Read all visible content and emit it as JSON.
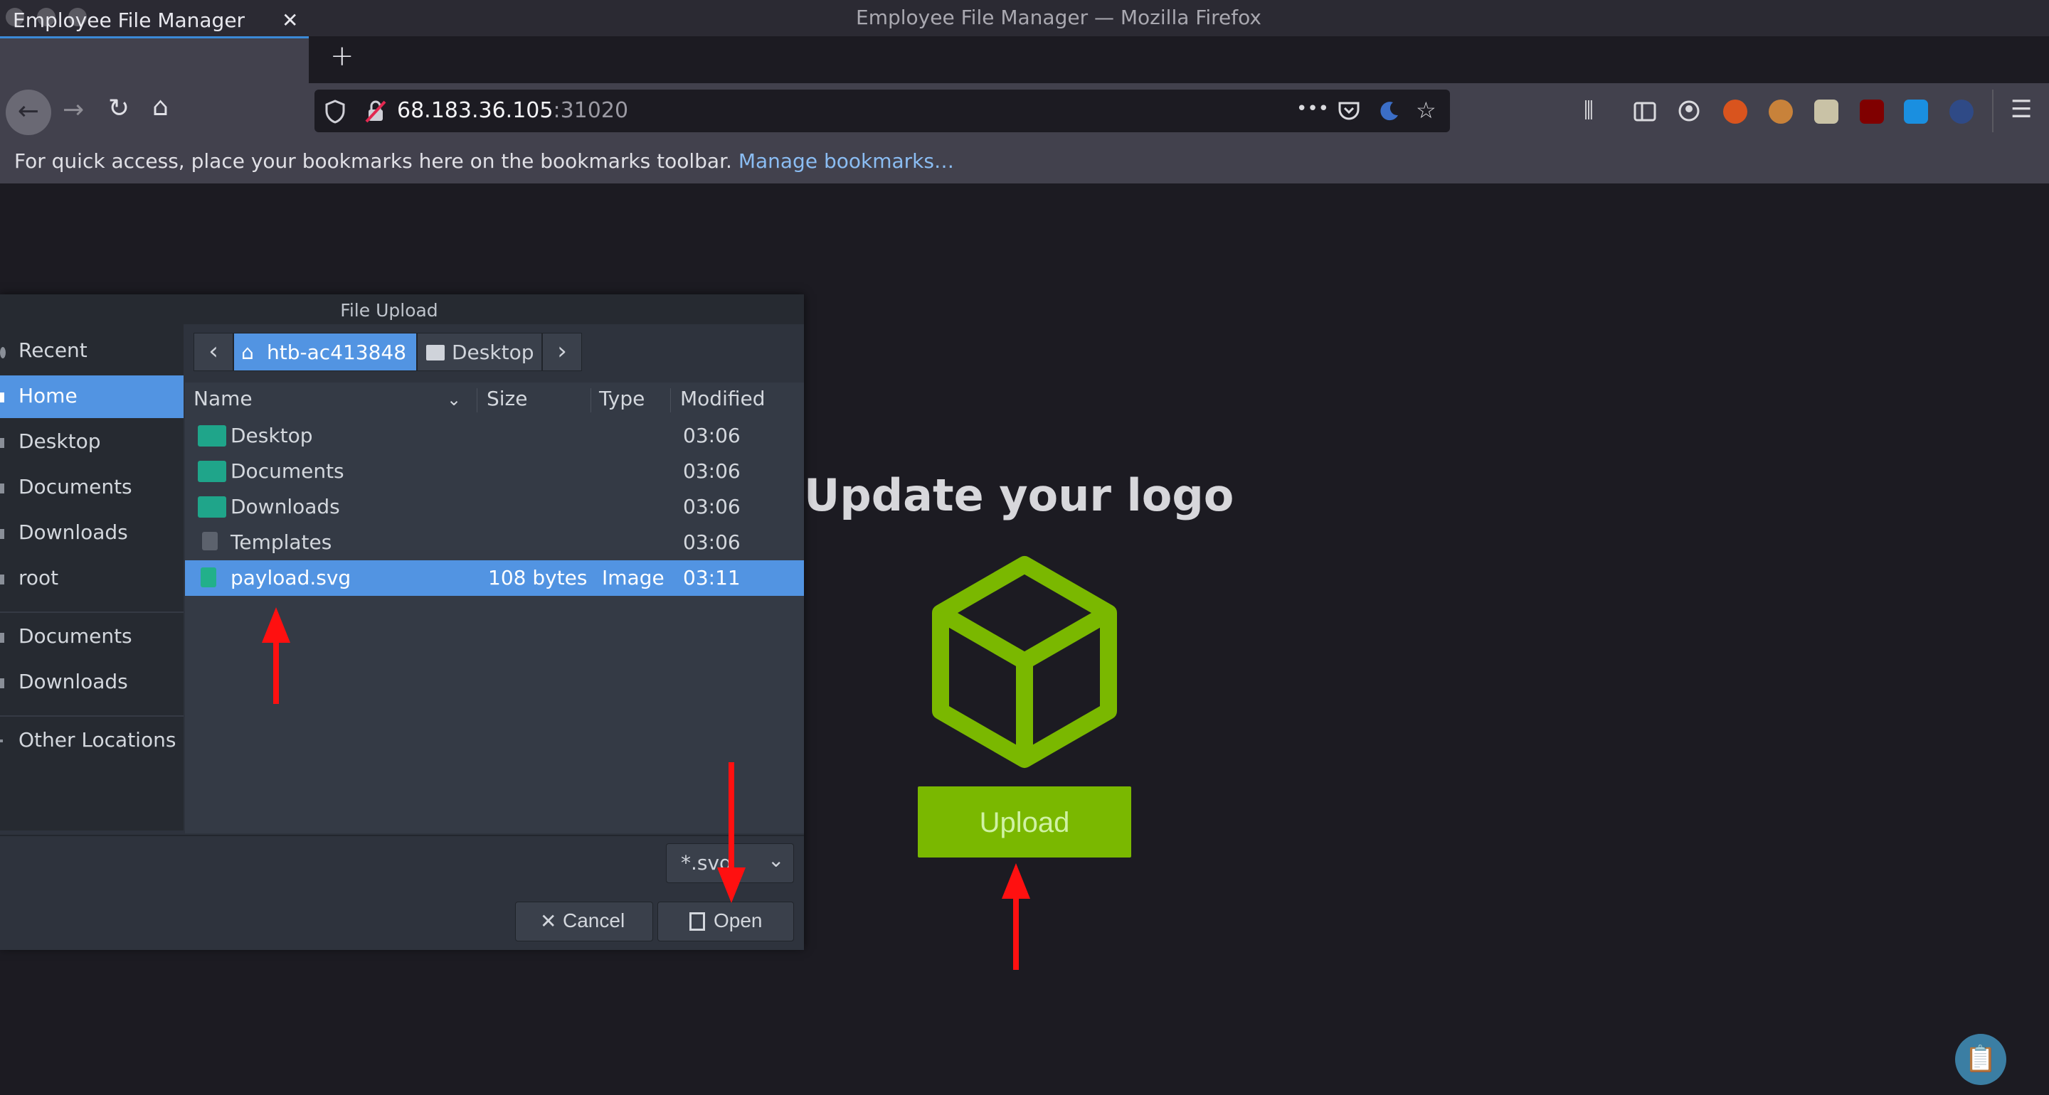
{
  "window": {
    "title": "Employee File Manager — Mozilla Firefox"
  },
  "tab": {
    "label": "Employee File Manager",
    "close_glyph": "✕",
    "new_tab_glyph": "+"
  },
  "nav": {
    "back_glyph": "←",
    "forward_glyph": "→",
    "reload_glyph": "↻",
    "home_glyph": "⌂",
    "url_host": "68.183.36.105",
    "url_port": ":31020",
    "menu_dots": "•••"
  },
  "bookmarks": {
    "message": "For quick access, place your bookmarks here on the bookmarks toolbar.",
    "link": "Manage bookmarks…"
  },
  "page": {
    "heading": "Update your logo",
    "upload_label": "Upload",
    "accent_color": "#7ab800"
  },
  "dialog": {
    "title": "File Upload",
    "sidebar": [
      {
        "label": "Recent"
      },
      {
        "label": "Home"
      },
      {
        "label": "Desktop"
      },
      {
        "label": "Documents"
      },
      {
        "label": "Downloads"
      },
      {
        "label": "root"
      },
      {
        "label": "Documents"
      },
      {
        "label": "Downloads"
      },
      {
        "label": "Other Locations"
      }
    ],
    "path": {
      "prev": "‹",
      "home": "htb-ac413848",
      "desktop": "Desktop",
      "next": "›"
    },
    "columns": {
      "name": "Name",
      "size": "Size",
      "type": "Type",
      "modified": "Modified"
    },
    "files": [
      {
        "name": "Desktop",
        "size": "",
        "type": "",
        "modified": "03:06",
        "icon": "folder-desktop-icon"
      },
      {
        "name": "Documents",
        "size": "",
        "type": "",
        "modified": "03:06",
        "icon": "folder-documents-icon"
      },
      {
        "name": "Downloads",
        "size": "",
        "type": "",
        "modified": "03:06",
        "icon": "folder-downloads-icon"
      },
      {
        "name": "Templates",
        "size": "",
        "type": "",
        "modified": "03:06",
        "icon": "templates-icon"
      },
      {
        "name": "payload.svg",
        "size": "108 bytes",
        "type": "Image",
        "modified": "03:11",
        "icon": "svg-file-icon"
      }
    ],
    "filter": "*.svg",
    "cancel_label": "Cancel",
    "open_label": "Open"
  }
}
